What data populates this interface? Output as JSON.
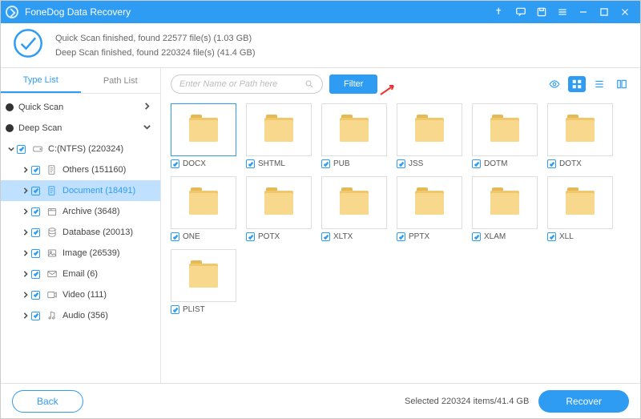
{
  "title": "FoneDog Data Recovery",
  "status": {
    "quick": "Quick Scan finished, found 22577 file(s) (1.03 GB)",
    "deep": "Deep Scan finished, found 220324 file(s) (41.4 GB)"
  },
  "tabs": {
    "type": "Type List",
    "path": "Path List"
  },
  "tree": {
    "quick": "Quick Scan",
    "deep": "Deep Scan",
    "drive": "C:(NTFS) (220324)",
    "items": [
      {
        "label": "Others (151160)",
        "icon": "file"
      },
      {
        "label": "Document (18491)",
        "icon": "doc",
        "selected": true
      },
      {
        "label": "Archive (3648)",
        "icon": "archive"
      },
      {
        "label": "Database (20013)",
        "icon": "db"
      },
      {
        "label": "Image (26539)",
        "icon": "image"
      },
      {
        "label": "Email (6)",
        "icon": "email"
      },
      {
        "label": "Video (111)",
        "icon": "video"
      },
      {
        "label": "Audio (356)",
        "icon": "audio"
      }
    ]
  },
  "search": {
    "placeholder": "Enter Name or Path here"
  },
  "filter": "Filter",
  "grid": {
    "row1": [
      "DOCX",
      "SHTML",
      "PUB",
      "JSS",
      "DOTM",
      "DOTX"
    ],
    "row2": [
      "ONE",
      "POTX",
      "XLTX",
      "PPTX",
      "XLAM",
      "XLL"
    ],
    "row3": [
      "PLIST"
    ]
  },
  "footer": {
    "back": "Back",
    "selected": "Selected 220324 items/41.4 GB",
    "recover": "Recover"
  }
}
